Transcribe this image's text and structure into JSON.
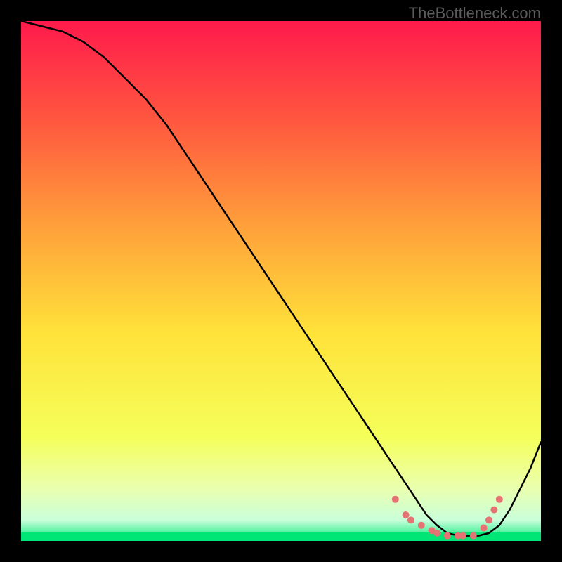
{
  "watermark": "TheBottleneck.com",
  "chart_data": {
    "type": "line",
    "title": "",
    "xlabel": "",
    "ylabel": "",
    "xlim": [
      0,
      100
    ],
    "ylim": [
      0,
      100
    ],
    "grid": false,
    "legend": false,
    "background_gradient_stops": [
      {
        "offset": 0.0,
        "color": "#ff1a4b"
      },
      {
        "offset": 0.2,
        "color": "#ff5a3f"
      },
      {
        "offset": 0.4,
        "color": "#ffa23a"
      },
      {
        "offset": 0.6,
        "color": "#ffe23a"
      },
      {
        "offset": 0.8,
        "color": "#f5ff5a"
      },
      {
        "offset": 0.9,
        "color": "#eaffb0"
      },
      {
        "offset": 0.96,
        "color": "#c9ffda"
      },
      {
        "offset": 1.0,
        "color": "#00e676"
      }
    ],
    "series": [
      {
        "name": "curve",
        "color": "#000000",
        "x": [
          0,
          4,
          8,
          12,
          16,
          20,
          24,
          28,
          32,
          36,
          40,
          44,
          48,
          52,
          56,
          60,
          64,
          68,
          72,
          74,
          76,
          78,
          80,
          82,
          84,
          86,
          88,
          90,
          92,
          94,
          96,
          98,
          100
        ],
        "y": [
          100,
          99,
          98,
          96,
          93,
          89,
          85,
          80,
          74,
          68,
          62,
          56,
          50,
          44,
          38,
          32,
          26,
          20,
          14,
          11,
          8,
          5,
          3,
          1.5,
          1,
          1,
          1,
          1.5,
          3,
          6,
          10,
          14,
          19
        ]
      }
    ],
    "markers": {
      "name": "dotted-region",
      "color": "#e57373",
      "x": [
        72,
        74,
        75,
        77,
        79,
        80,
        82,
        84,
        85,
        87,
        89,
        90,
        91,
        92
      ],
      "y": [
        8,
        5,
        4,
        3,
        2,
        1.5,
        1,
        1,
        1,
        1,
        2.5,
        4,
        6,
        8
      ]
    }
  }
}
